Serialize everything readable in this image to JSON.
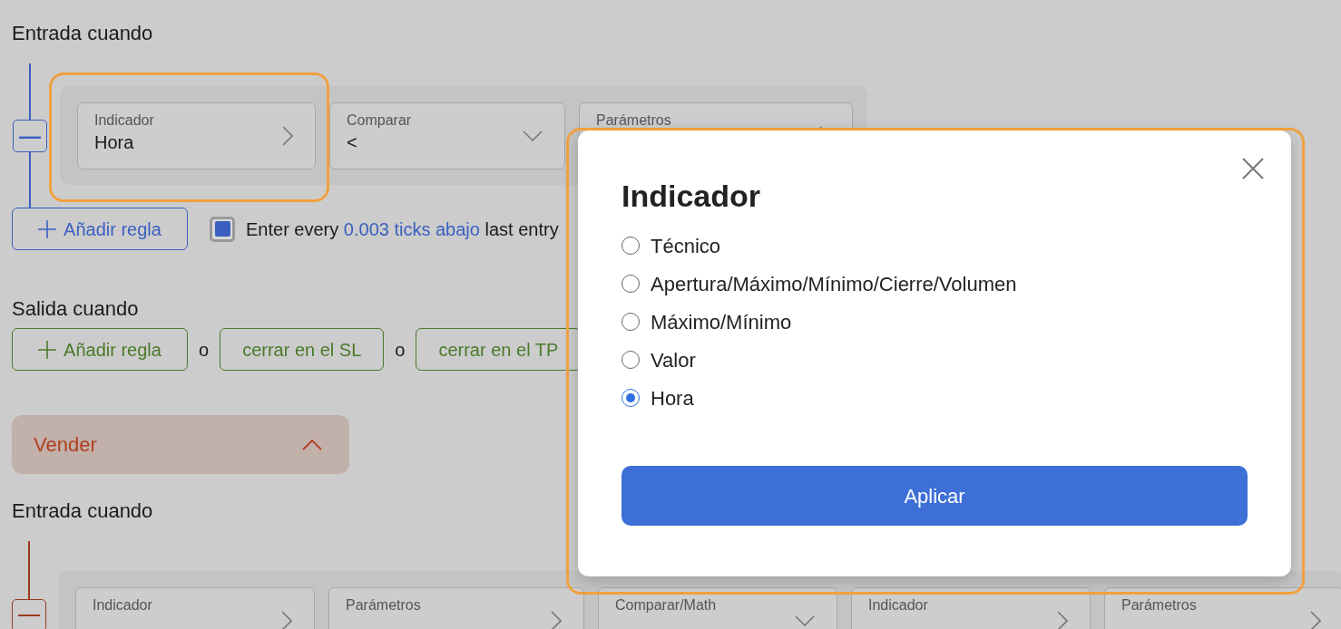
{
  "buy_entry": {
    "title": "Entrada cuando",
    "remove": "—",
    "rule": [
      {
        "label": "Indicador",
        "value": "Hora",
        "kind": "nav"
      },
      {
        "label": "Comparar",
        "value": "<",
        "kind": "select"
      },
      {
        "label": "Parámetros",
        "kind": "nav"
      }
    ],
    "add_rule": "Añadir regla",
    "repeat": {
      "checked": true,
      "prefix": "Enter every",
      "link": "0.003 ticks abajo",
      "suffix": "last entry"
    }
  },
  "exit": {
    "title": "Salida cuando",
    "items": [
      {
        "kind": "add",
        "label": "Añadir regla"
      },
      {
        "kind": "text",
        "label": "o"
      },
      {
        "kind": "button",
        "label": "cerrar en el SL"
      },
      {
        "kind": "text",
        "label": "o"
      },
      {
        "kind": "button",
        "label": "cerrar en el TP"
      }
    ]
  },
  "sell": {
    "title": "Vender",
    "expanded": true
  },
  "sell_entry": {
    "title": "Entrada cuando",
    "rule": [
      {
        "label": "Indicador",
        "kind": "nav"
      },
      {
        "label": "Parámetros",
        "kind": "nav"
      },
      {
        "label": "Comparar/Math",
        "kind": "select"
      },
      {
        "label": "Indicador",
        "kind": "nav"
      },
      {
        "label": "Parámetros",
        "kind": "nav"
      }
    ]
  },
  "modal": {
    "title": "Indicador",
    "options": [
      {
        "label": "Técnico",
        "selected": false
      },
      {
        "label": "Apertura/Máximo/Mínimo/Cierre/Volumen",
        "selected": false
      },
      {
        "label": "Máximo/Mínimo",
        "selected": false
      },
      {
        "label": "Valor",
        "selected": false
      },
      {
        "label": "Hora",
        "selected": true
      }
    ],
    "apply": "Aplicar"
  }
}
